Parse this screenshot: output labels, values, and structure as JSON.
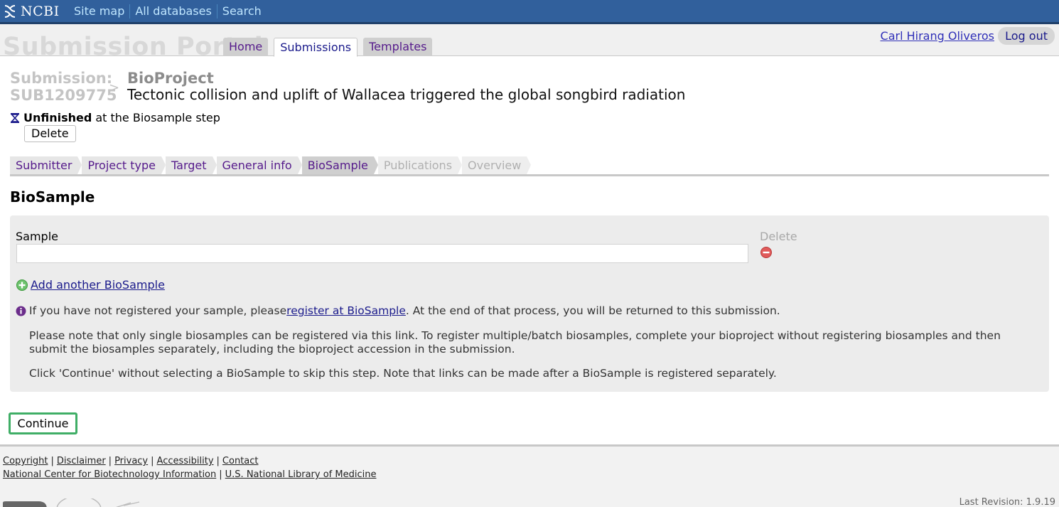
{
  "topbar": {
    "logo_text": "NCBI",
    "links": [
      "Site map",
      "All databases",
      "Search"
    ]
  },
  "header": {
    "portal_title": "Submission Portal",
    "tabs": [
      "Home",
      "Submissions",
      "Templates"
    ],
    "active_tab": "Submissions",
    "user_name": "Carl Hirang Oliveros",
    "logout_label": "Log out"
  },
  "submission": {
    "label_line1": "Submission:",
    "label_line2": "SUB1209775",
    "arrow": ">",
    "type": "BioProject",
    "title": "Tectonic collision and uplift of Wallacea triggered the global songbird radiation",
    "status_bold": "Unfinished",
    "status_rest": "at the Biosample step",
    "delete_label": "Delete"
  },
  "steps": [
    {
      "label": "Submitter",
      "state": "done"
    },
    {
      "label": "Project type",
      "state": "done"
    },
    {
      "label": "Target",
      "state": "done"
    },
    {
      "label": "General info",
      "state": "done"
    },
    {
      "label": "BioSample",
      "state": "active"
    },
    {
      "label": "Publications",
      "state": "disabled"
    },
    {
      "label": "Overview",
      "state": "disabled"
    }
  ],
  "section": {
    "title": "BioSample",
    "sample_label": "Sample",
    "sample_value": "",
    "delete_column_label": "Delete",
    "add_link": "Add another BioSample",
    "info_before": "If you have not registered your sample, please ",
    "info_link": "register at BioSample",
    "info_after": ". At the end of that process, you will be returned to this submission.",
    "note1": "Please note that only single biosamples can be registered via this link. To register multiple/batch biosamples, complete your bioproject without registering biosamples and then submit the biosamples separately, including the bioproject accession in the submission.",
    "note2": "Click 'Continue' without selecting a BioSample to skip this step. Note that links can be made after a BioSample is registered separately."
  },
  "continue_label": "Continue",
  "footer": {
    "line1": [
      "Copyright",
      "Disclaimer",
      "Privacy",
      "Accessibility",
      "Contact"
    ],
    "line2": [
      "National Center for Biotechnology Information",
      "U.S. National Library of Medicine"
    ],
    "revision": "Last Revision: 1.9.19"
  },
  "colors": {
    "topbar": "#31609c",
    "link": "#1a1a8b",
    "continue_border": "#3fae66"
  },
  "icons": [
    "ncbi-helix-icon",
    "hourglass-icon",
    "remove-icon",
    "add-icon",
    "info-icon"
  ]
}
